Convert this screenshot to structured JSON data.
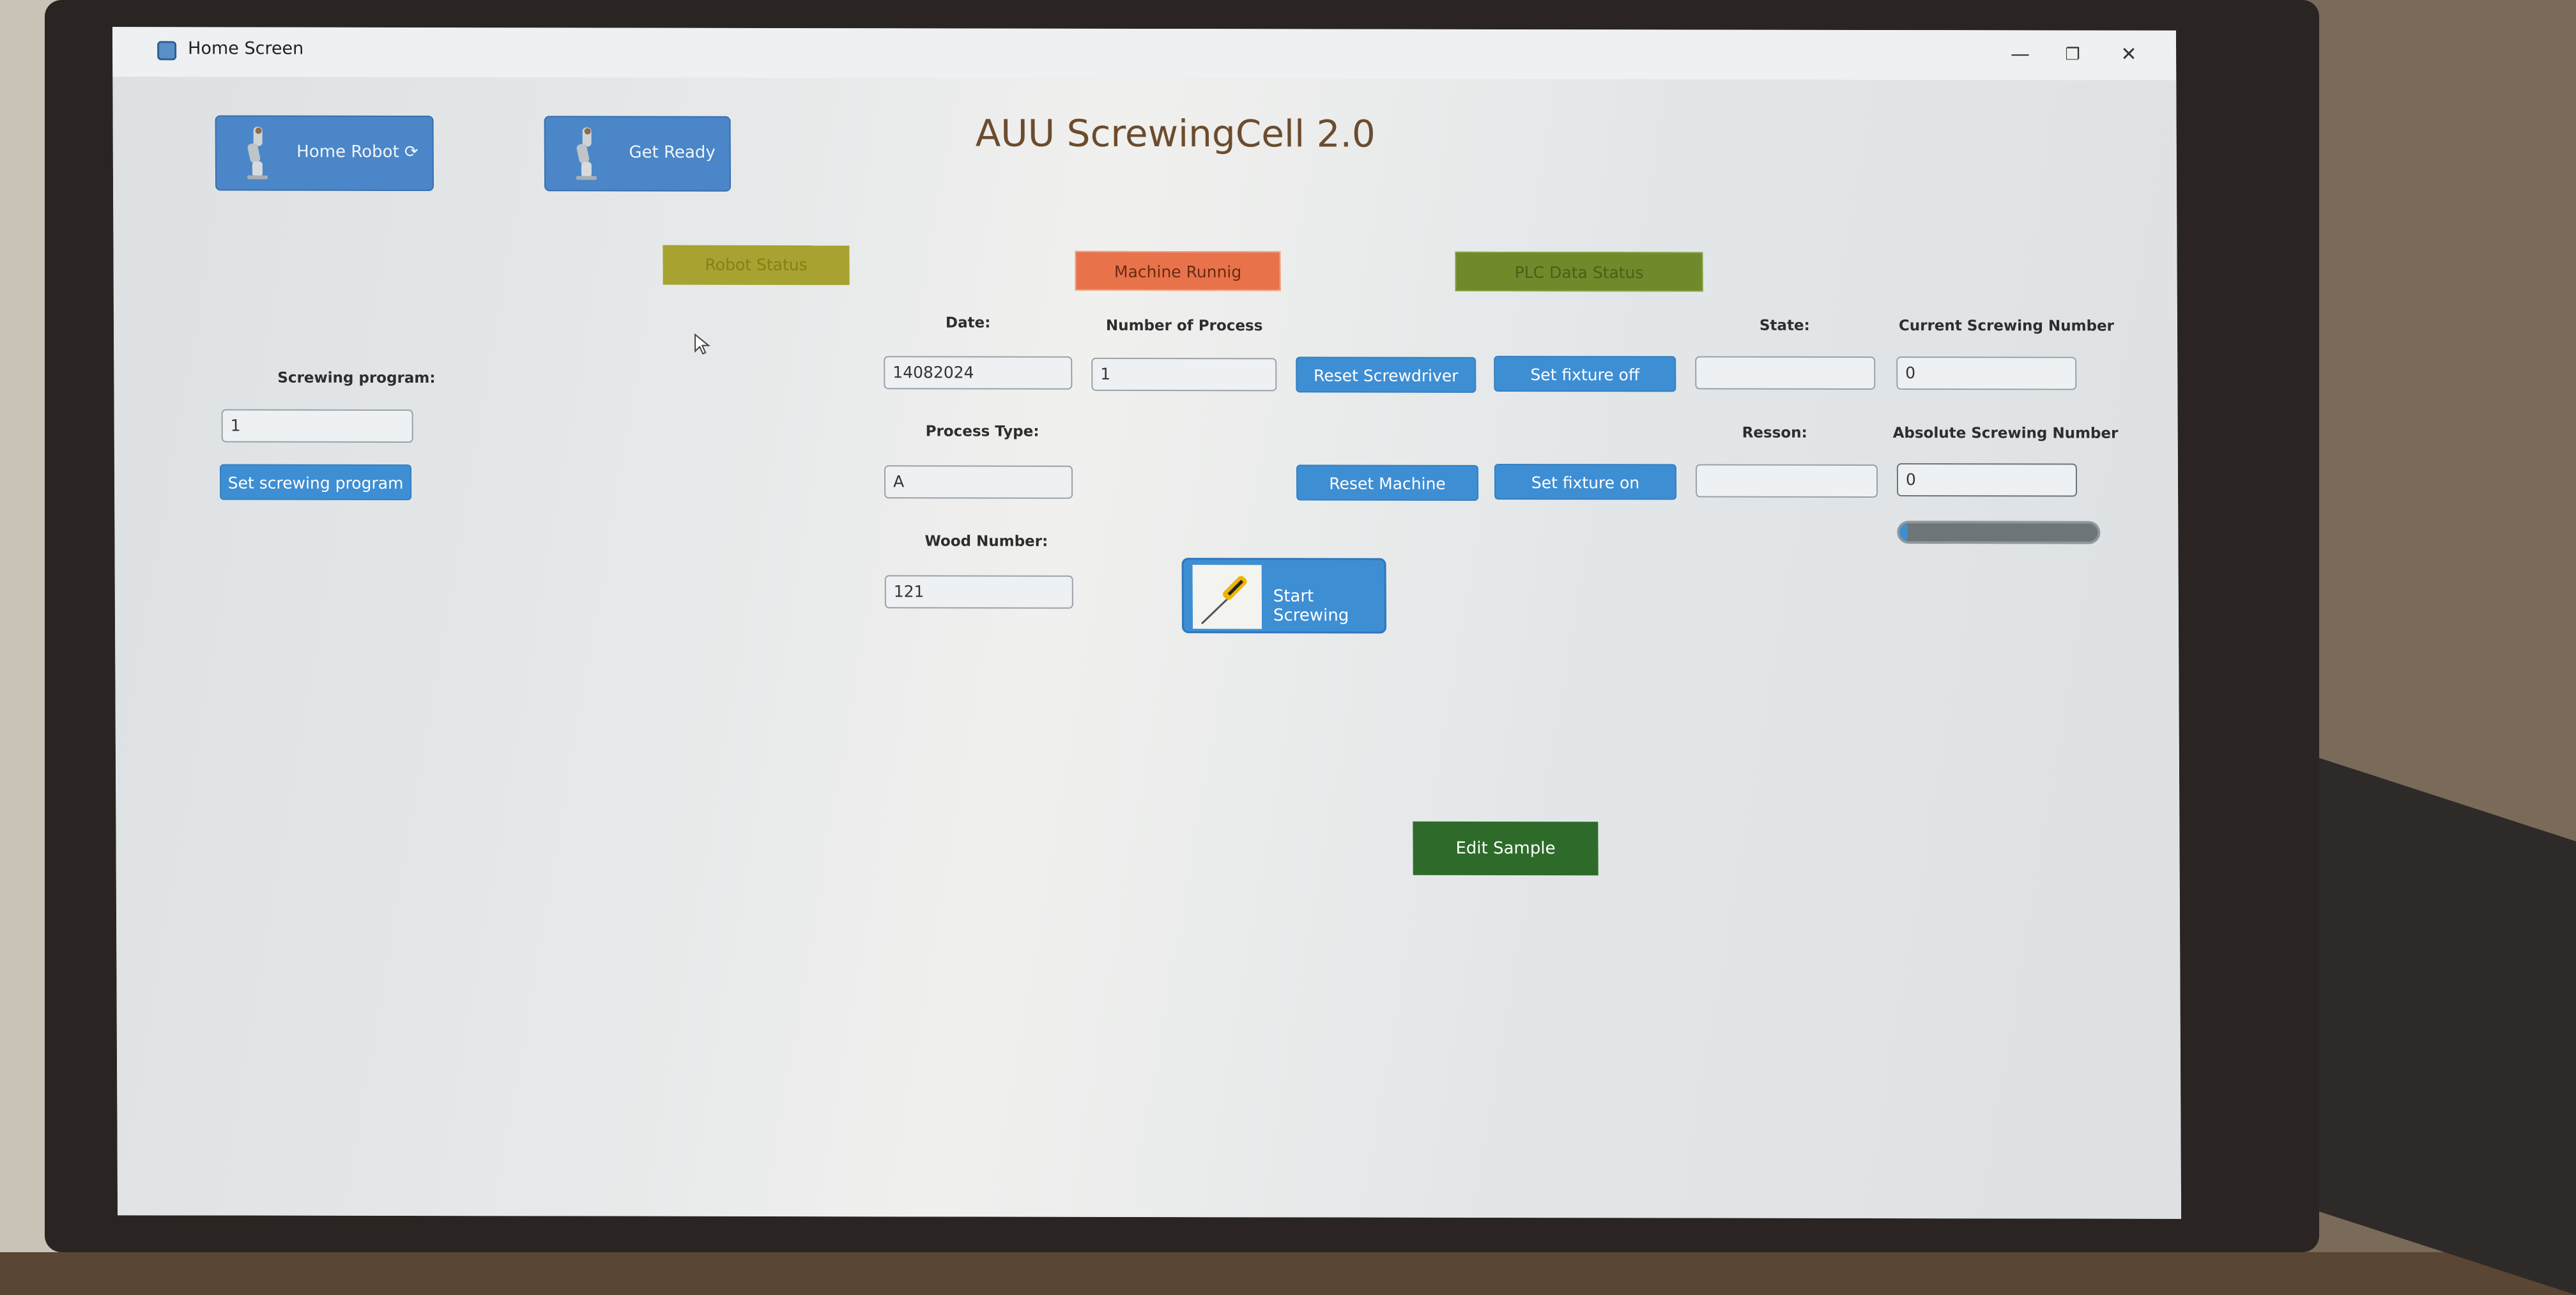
{
  "window": {
    "title": "Home Screen",
    "controls": {
      "minimize": "—",
      "maximize": "❐",
      "close": "✕"
    }
  },
  "toolbar": {
    "home_robot_label": "Home Robot",
    "home_robot_suffix": "⟳",
    "get_ready_label": "Get Ready"
  },
  "app_title": "AUU ScrewingCell 2.0",
  "status": {
    "robot_status": "Robot Status",
    "machine_running": "Machine Runnig",
    "plc_data_status": "PLC Data Status"
  },
  "left_panel": {
    "screwing_program_label": "Screwing program:",
    "screwing_program_value": "1",
    "set_program_button": "Set screwing program"
  },
  "labels": {
    "date": "Date:",
    "number_of_process": "Number of Process",
    "state": "State:",
    "current_screwing_number": "Current Screwing Number",
    "process_type": "Process Type:",
    "resson": "Resson:",
    "absolute_screwing_number": "Absolute Screwing Number",
    "wood_number": "Wood Number:"
  },
  "fields": {
    "date": "14082024",
    "number_of_process": "1",
    "state": "",
    "current_screwing_number": "0",
    "process_type": "A",
    "resson": "",
    "absolute_screwing_number": "0",
    "wood_number": "121"
  },
  "buttons": {
    "reset_screwdriver": "Reset Screwdriver",
    "set_fixture_off": "Set fixture off",
    "reset_machine": "Reset Machine",
    "set_fixture_on": "Set fixture on",
    "start_screwing": "Start Screwing",
    "edit_sample": "Edit Sample"
  },
  "progress": {
    "value": 0.04
  },
  "colors": {
    "button_blue": "#3e8ed3",
    "robot_status_bg": "#a8a230",
    "machine_running_bg": "#e8734a",
    "plc_status_bg": "#6f8a2a",
    "edit_sample_bg": "#2e6b2a",
    "title_color": "#6b4c2e"
  }
}
